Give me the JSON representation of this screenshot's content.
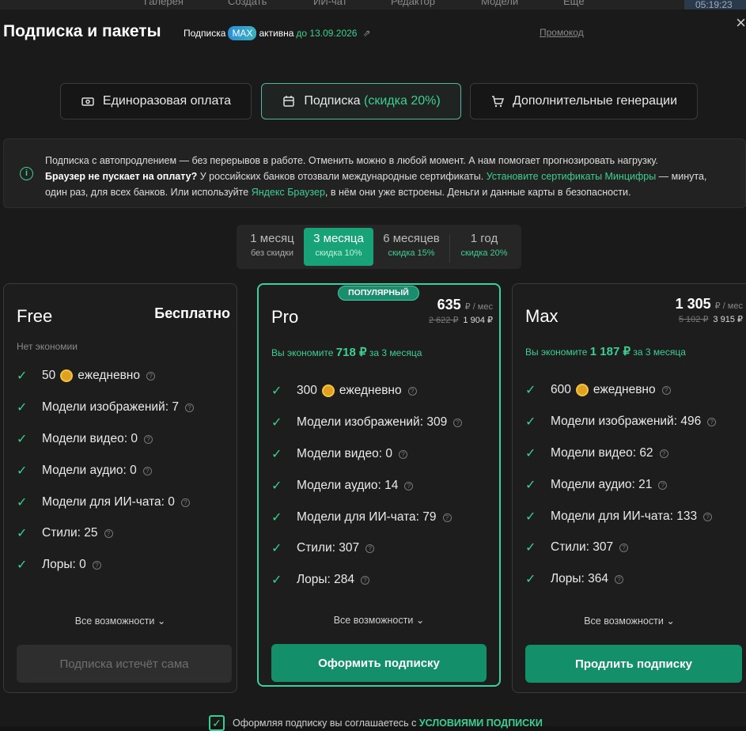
{
  "topnav": {
    "items": [
      "Галерея",
      "Создать",
      "ИИ-чат",
      "Редактор",
      "Модели",
      "Ещё"
    ],
    "clock": "05:19:23"
  },
  "modal": {
    "title": "Подписка и пакеты",
    "status": {
      "prefix": "Подписка",
      "plan": "MAX",
      "active": "активна",
      "until": "до 13.09.2026"
    },
    "promo": "Промокод",
    "close": "×"
  },
  "tabs": [
    {
      "label": "Единоразовая оплата",
      "discount": ""
    },
    {
      "label": "Подписка",
      "discount": "(скидка 20%)"
    },
    {
      "label": "Дополнительные генерации",
      "discount": ""
    }
  ],
  "notice": {
    "line1": "Подписка с автопродлением — без перерывов в работе. Отменить можно в любой момент. А нам помогает прогнозировать нагрузку.",
    "bold": "Браузер не пускает на оплату?",
    "line2a": " У российских банков отозвали международные сертификаты.",
    "link1": "Установите сертификаты Минцифры",
    "line2b": " — минута,",
    "line3a": "один раз, для всех банков. Или используйте",
    "link2": "Яндекс Браузер",
    "line3b": ", в нём они уже встроены. Деньги и данные карты в безопасности."
  },
  "periods": [
    {
      "label": "1 месяц",
      "sub": "без скидки"
    },
    {
      "label": "3 месяца",
      "sub": "скидка 10%"
    },
    {
      "label": "6 месяцев",
      "sub": "скидка 15%"
    },
    {
      "label": "1 год",
      "sub": "скидка 20%"
    }
  ],
  "selected_period": "3 месяца",
  "popular_tag": "ПОПУЛЯРНЫЙ",
  "plans": [
    {
      "name": "Free",
      "price": "Бесплатно",
      "savings": "Нет экономии",
      "features": [
        "50",
        "Модели изображений: 7",
        "Модели видео: 0",
        "Модели аудио: 0",
        "Модели для ИИ-чата: 0",
        "Стили: 25",
        "Лоры: 0"
      ],
      "daily": "ежедневно",
      "all": "Все возможности",
      "button": "Подписка истечёт сама"
    },
    {
      "name": "Pro",
      "price": "635",
      "per": "₽ / мес",
      "old": "2 622 ₽",
      "new": "1 904 ₽",
      "save_pre": "Вы экономите",
      "save_amt": "718 ₽",
      "save_post": "за 3 месяца",
      "features": [
        "300",
        "Модели изображений: 309",
        "Модели видео: 0",
        "Модели аудио: 14",
        "Модели для ИИ-чата: 79",
        "Стили: 307",
        "Лоры: 284"
      ],
      "daily": "ежедневно",
      "all": "Все возможности",
      "button": "Оформить подписку"
    },
    {
      "name": "Max",
      "price": "1 305",
      "per": "₽ / мес",
      "old": "5 102 ₽",
      "new": "3 915 ₽",
      "save_pre": "Вы экономите",
      "save_amt": "1 187 ₽",
      "save_post": "за 3 месяца",
      "features": [
        "600",
        "Модели изображений: 496",
        "Модели видео: 62",
        "Модели аудио: 21",
        "Модели для ИИ-чата: 133",
        "Стили: 307",
        "Лоры: 364"
      ],
      "daily": "ежедневно",
      "all": "Все возможности",
      "button": "Продлить подписку"
    }
  ],
  "agree": {
    "text": "Оформляя подписку вы соглашаетесь с",
    "link": "УСЛОВИЯМИ ПОДПИСКИ"
  },
  "colors": {
    "accent": "#3ccf92",
    "button": "#13906a",
    "selected": "#17a377"
  }
}
